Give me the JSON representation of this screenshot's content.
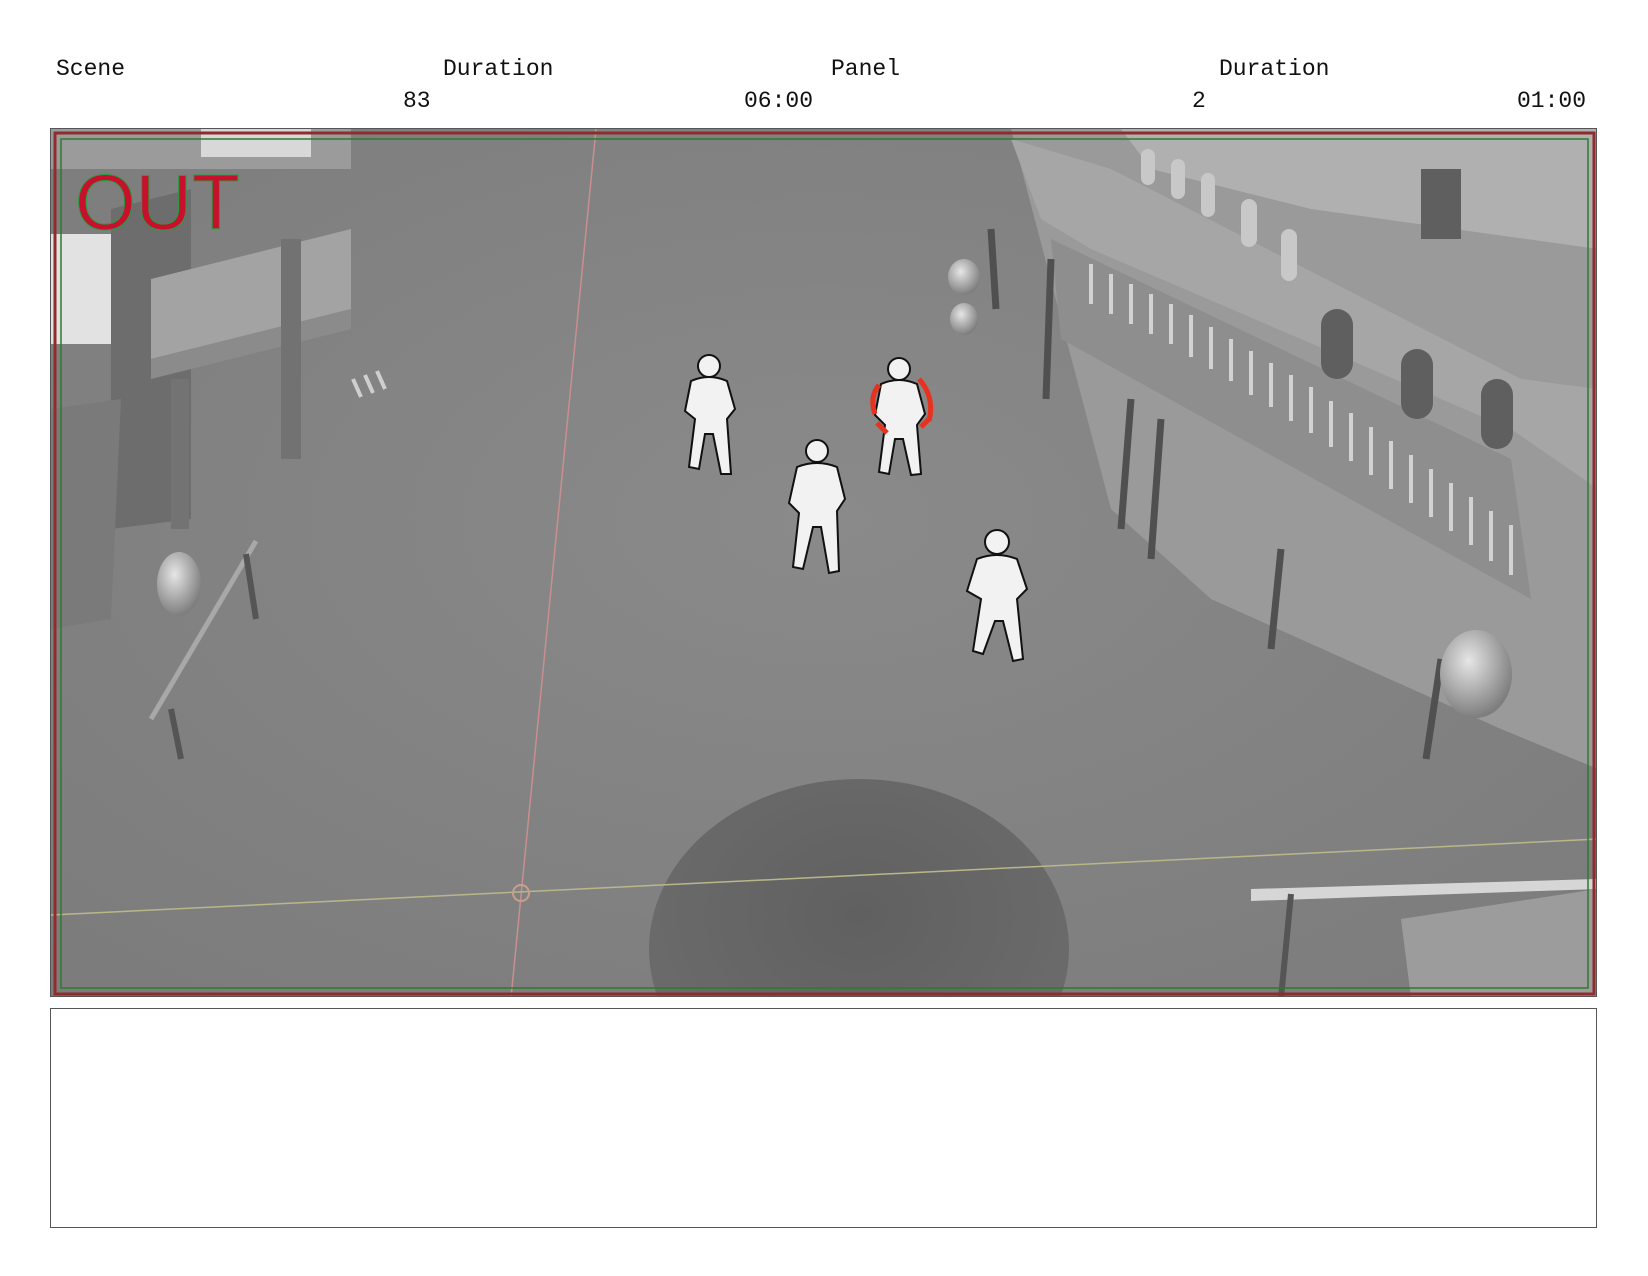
{
  "header": {
    "scene_label": "Scene",
    "scene_value": "83",
    "scene_duration_label": "Duration",
    "scene_duration_value": "06:00",
    "panel_label": "Panel",
    "panel_value": "2",
    "panel_duration_label": "Duration",
    "panel_duration_value": "01:00"
  },
  "panel": {
    "overlay_text": "OUT",
    "overlay_color": "#c8102e",
    "overlay_accent_color": "#1fa23a"
  },
  "notes": {
    "text": ""
  }
}
